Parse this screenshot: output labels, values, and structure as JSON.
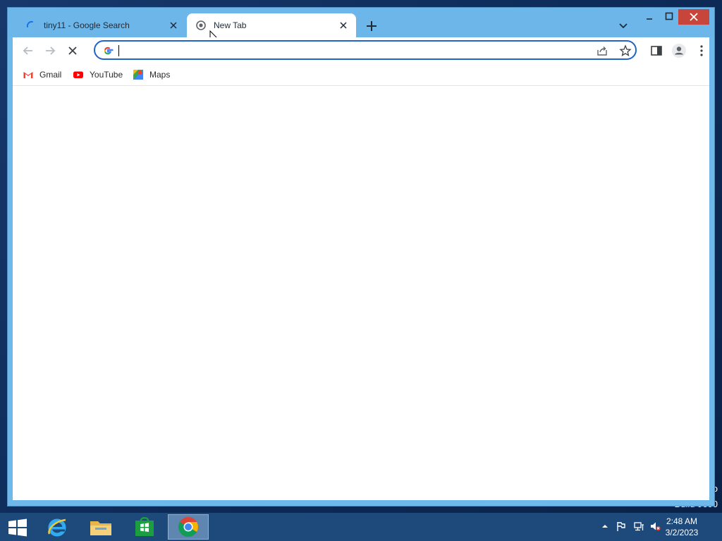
{
  "watermark": {
    "line1": "o",
    "line2": "Build 9600"
  },
  "browser": {
    "tabs": [
      {
        "title": "tiny11 - Google Search",
        "active": false,
        "loading": true
      },
      {
        "title": "New Tab",
        "active": true,
        "loading": true
      }
    ],
    "omnibox": {
      "value": "",
      "placeholder": ""
    },
    "bookmarks": [
      {
        "label": "Gmail",
        "icon": "gmail-icon"
      },
      {
        "label": "YouTube",
        "icon": "youtube-icon"
      },
      {
        "label": "Maps",
        "icon": "maps-icon"
      }
    ]
  },
  "taskbar": {
    "apps": [
      "internet-explorer-icon",
      "file-explorer-icon",
      "store-icon",
      "chrome-icon"
    ],
    "active_app": "chrome-icon",
    "clock": {
      "time": "2:48 AM",
      "date": "3/2/2023"
    }
  },
  "colors": {
    "titlebar": "#6db6ea",
    "close_button": "#c7453a",
    "omnibox_border": "#1f64c8",
    "taskbar": "#1d4a7a"
  }
}
